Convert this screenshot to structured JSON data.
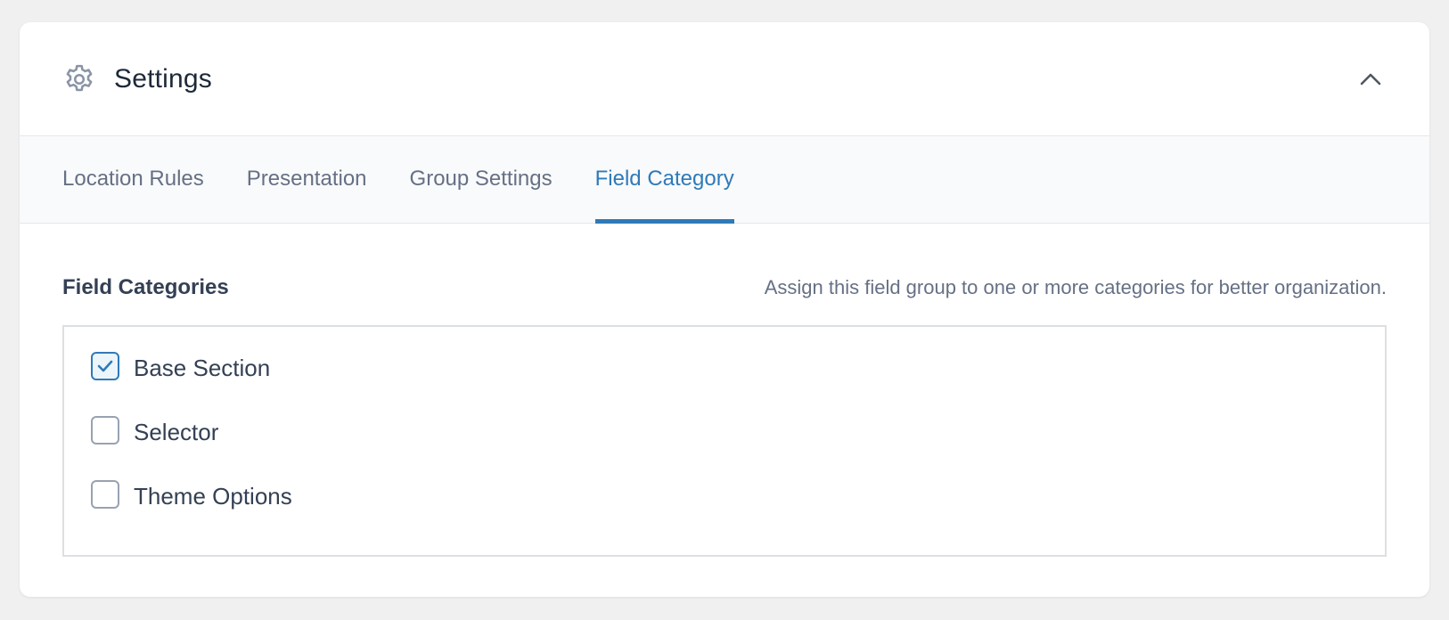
{
  "header": {
    "title": "Settings",
    "icon": "gear-icon",
    "collapse_icon": "chevron-up-icon"
  },
  "tabs": [
    {
      "label": "Location Rules",
      "active": false
    },
    {
      "label": "Presentation",
      "active": false
    },
    {
      "label": "Group Settings",
      "active": false
    },
    {
      "label": "Field Category",
      "active": true
    }
  ],
  "field": {
    "label": "Field Categories",
    "description": "Assign this field group to one or more categories for better organization."
  },
  "categories": [
    {
      "label": "Base Section",
      "checked": true
    },
    {
      "label": "Selector",
      "checked": false
    },
    {
      "label": "Theme Options",
      "checked": false
    }
  ],
  "colors": {
    "accent": "#2f7ab8",
    "page_bg": "#f0f0f1",
    "tabs_bg": "#f9fafb"
  }
}
